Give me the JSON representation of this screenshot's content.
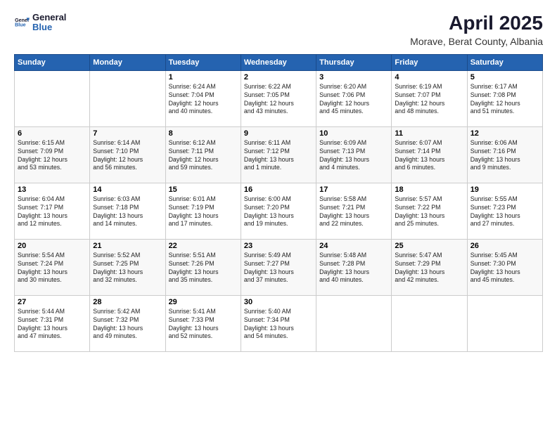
{
  "header": {
    "logo_general": "General",
    "logo_blue": "Blue",
    "title": "April 2025",
    "subtitle": "Morave, Berat County, Albania"
  },
  "calendar": {
    "days_of_week": [
      "Sunday",
      "Monday",
      "Tuesday",
      "Wednesday",
      "Thursday",
      "Friday",
      "Saturday"
    ],
    "weeks": [
      [
        {
          "day": "",
          "info": ""
        },
        {
          "day": "",
          "info": ""
        },
        {
          "day": "1",
          "info": "Sunrise: 6:24 AM\nSunset: 7:04 PM\nDaylight: 12 hours\nand 40 minutes."
        },
        {
          "day": "2",
          "info": "Sunrise: 6:22 AM\nSunset: 7:05 PM\nDaylight: 12 hours\nand 43 minutes."
        },
        {
          "day": "3",
          "info": "Sunrise: 6:20 AM\nSunset: 7:06 PM\nDaylight: 12 hours\nand 45 minutes."
        },
        {
          "day": "4",
          "info": "Sunrise: 6:19 AM\nSunset: 7:07 PM\nDaylight: 12 hours\nand 48 minutes."
        },
        {
          "day": "5",
          "info": "Sunrise: 6:17 AM\nSunset: 7:08 PM\nDaylight: 12 hours\nand 51 minutes."
        }
      ],
      [
        {
          "day": "6",
          "info": "Sunrise: 6:15 AM\nSunset: 7:09 PM\nDaylight: 12 hours\nand 53 minutes."
        },
        {
          "day": "7",
          "info": "Sunrise: 6:14 AM\nSunset: 7:10 PM\nDaylight: 12 hours\nand 56 minutes."
        },
        {
          "day": "8",
          "info": "Sunrise: 6:12 AM\nSunset: 7:11 PM\nDaylight: 12 hours\nand 59 minutes."
        },
        {
          "day": "9",
          "info": "Sunrise: 6:11 AM\nSunset: 7:12 PM\nDaylight: 13 hours\nand 1 minute."
        },
        {
          "day": "10",
          "info": "Sunrise: 6:09 AM\nSunset: 7:13 PM\nDaylight: 13 hours\nand 4 minutes."
        },
        {
          "day": "11",
          "info": "Sunrise: 6:07 AM\nSunset: 7:14 PM\nDaylight: 13 hours\nand 6 minutes."
        },
        {
          "day": "12",
          "info": "Sunrise: 6:06 AM\nSunset: 7:16 PM\nDaylight: 13 hours\nand 9 minutes."
        }
      ],
      [
        {
          "day": "13",
          "info": "Sunrise: 6:04 AM\nSunset: 7:17 PM\nDaylight: 13 hours\nand 12 minutes."
        },
        {
          "day": "14",
          "info": "Sunrise: 6:03 AM\nSunset: 7:18 PM\nDaylight: 13 hours\nand 14 minutes."
        },
        {
          "day": "15",
          "info": "Sunrise: 6:01 AM\nSunset: 7:19 PM\nDaylight: 13 hours\nand 17 minutes."
        },
        {
          "day": "16",
          "info": "Sunrise: 6:00 AM\nSunset: 7:20 PM\nDaylight: 13 hours\nand 19 minutes."
        },
        {
          "day": "17",
          "info": "Sunrise: 5:58 AM\nSunset: 7:21 PM\nDaylight: 13 hours\nand 22 minutes."
        },
        {
          "day": "18",
          "info": "Sunrise: 5:57 AM\nSunset: 7:22 PM\nDaylight: 13 hours\nand 25 minutes."
        },
        {
          "day": "19",
          "info": "Sunrise: 5:55 AM\nSunset: 7:23 PM\nDaylight: 13 hours\nand 27 minutes."
        }
      ],
      [
        {
          "day": "20",
          "info": "Sunrise: 5:54 AM\nSunset: 7:24 PM\nDaylight: 13 hours\nand 30 minutes."
        },
        {
          "day": "21",
          "info": "Sunrise: 5:52 AM\nSunset: 7:25 PM\nDaylight: 13 hours\nand 32 minutes."
        },
        {
          "day": "22",
          "info": "Sunrise: 5:51 AM\nSunset: 7:26 PM\nDaylight: 13 hours\nand 35 minutes."
        },
        {
          "day": "23",
          "info": "Sunrise: 5:49 AM\nSunset: 7:27 PM\nDaylight: 13 hours\nand 37 minutes."
        },
        {
          "day": "24",
          "info": "Sunrise: 5:48 AM\nSunset: 7:28 PM\nDaylight: 13 hours\nand 40 minutes."
        },
        {
          "day": "25",
          "info": "Sunrise: 5:47 AM\nSunset: 7:29 PM\nDaylight: 13 hours\nand 42 minutes."
        },
        {
          "day": "26",
          "info": "Sunrise: 5:45 AM\nSunset: 7:30 PM\nDaylight: 13 hours\nand 45 minutes."
        }
      ],
      [
        {
          "day": "27",
          "info": "Sunrise: 5:44 AM\nSunset: 7:31 PM\nDaylight: 13 hours\nand 47 minutes."
        },
        {
          "day": "28",
          "info": "Sunrise: 5:42 AM\nSunset: 7:32 PM\nDaylight: 13 hours\nand 49 minutes."
        },
        {
          "day": "29",
          "info": "Sunrise: 5:41 AM\nSunset: 7:33 PM\nDaylight: 13 hours\nand 52 minutes."
        },
        {
          "day": "30",
          "info": "Sunrise: 5:40 AM\nSunset: 7:34 PM\nDaylight: 13 hours\nand 54 minutes."
        },
        {
          "day": "",
          "info": ""
        },
        {
          "day": "",
          "info": ""
        },
        {
          "day": "",
          "info": ""
        }
      ]
    ]
  }
}
